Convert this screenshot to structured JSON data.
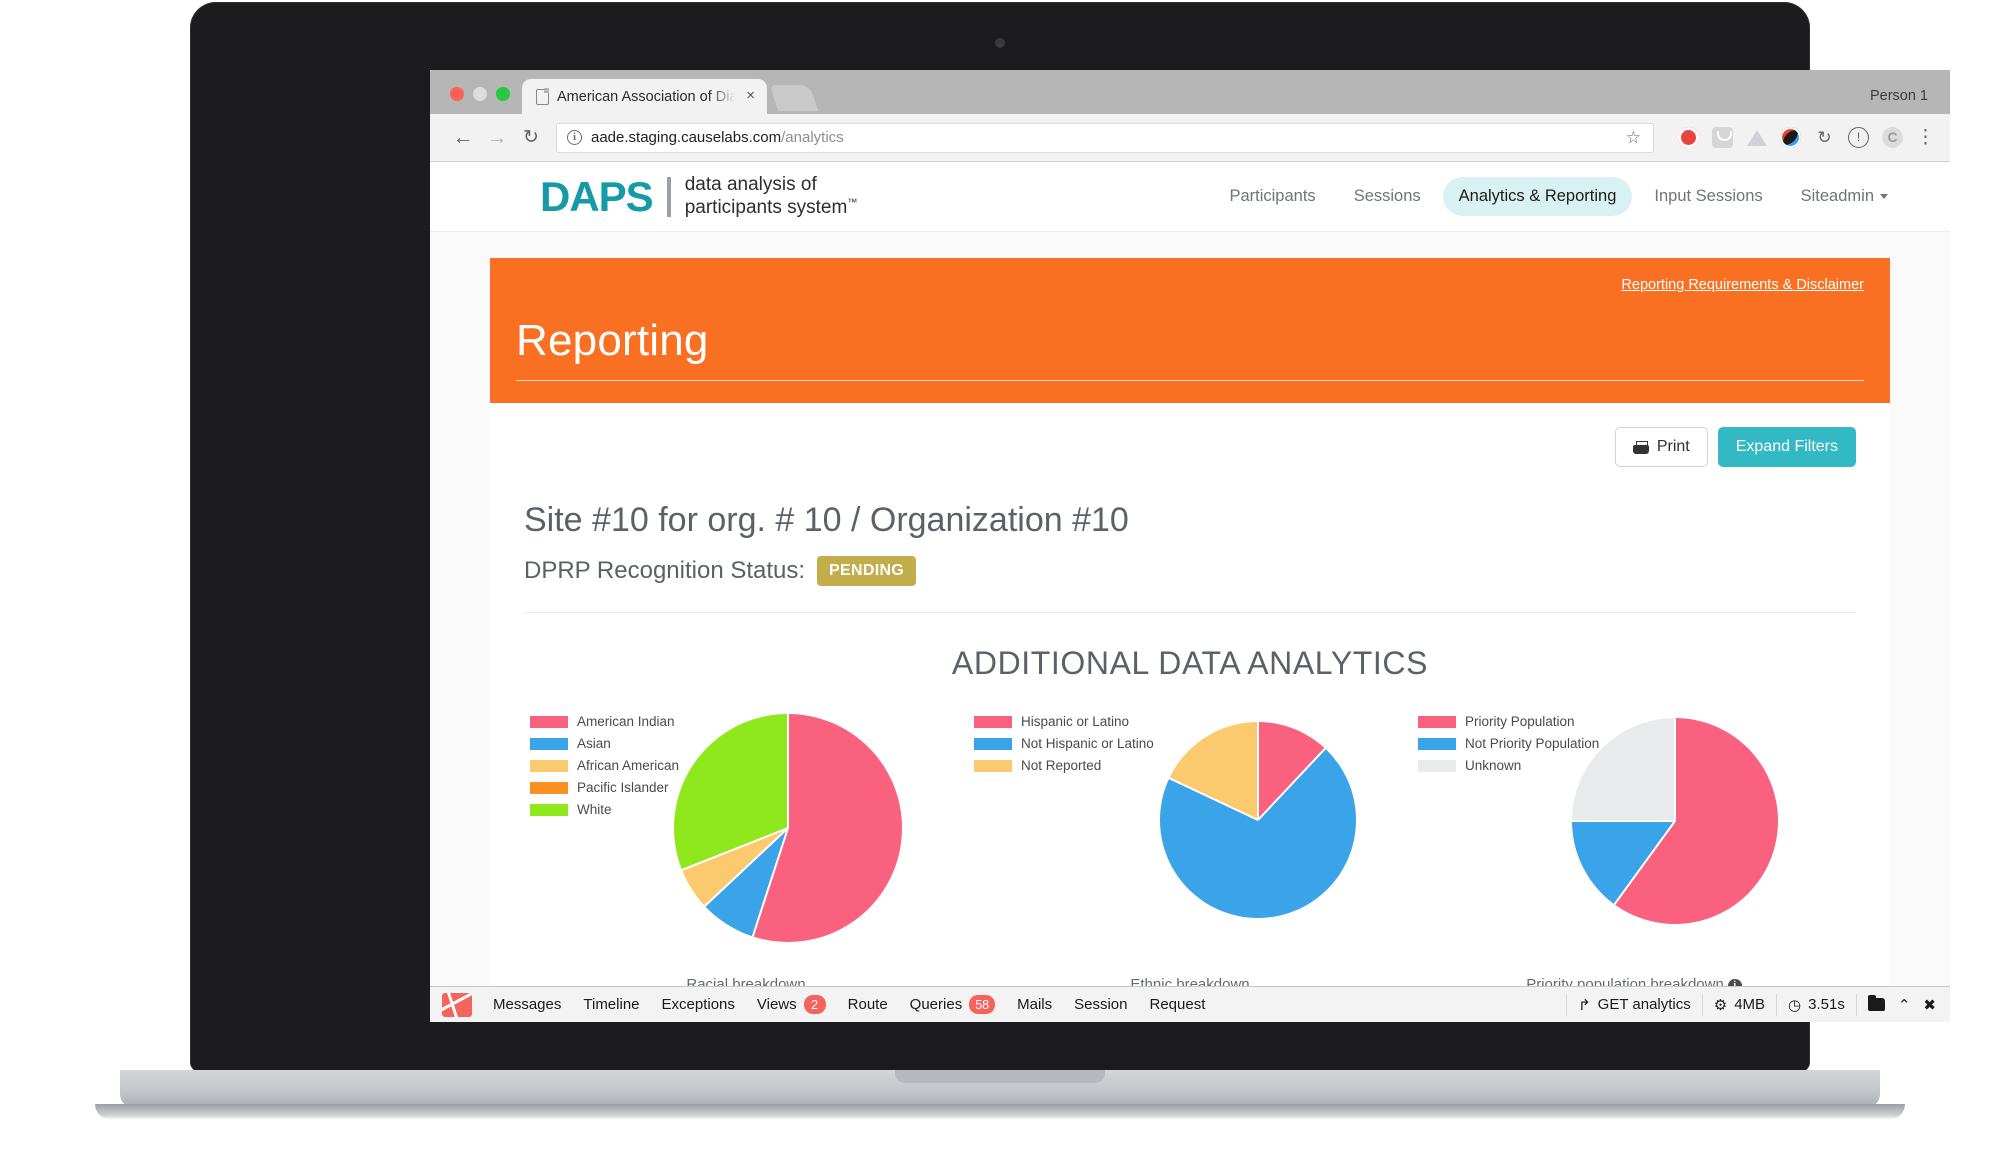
{
  "browser": {
    "tab_title": "American Association of Diabe",
    "tab_close": "×",
    "profile_label": "Person 1",
    "url_host": "aade.staging.causelabs.com",
    "url_path": "/analytics",
    "back_icon": "←",
    "forward_icon": "→",
    "reload_icon": "↻",
    "star_icon": "☆",
    "kebab_icon": "⋮",
    "sync_icon": "↻",
    "down_icon": "!",
    "gray_icon": "C"
  },
  "sitenav": {
    "logo_main": "DAPS",
    "logo_line1": "data analysis of",
    "logo_line2": "participants system",
    "logo_tm": "™",
    "links": [
      {
        "label": "Participants",
        "active": false
      },
      {
        "label": "Sessions",
        "active": false
      },
      {
        "label": "Analytics & Reporting",
        "active": true
      },
      {
        "label": "Input Sessions",
        "active": false
      },
      {
        "label": "Siteadmin",
        "active": false,
        "caret": true
      }
    ]
  },
  "header": {
    "disclaimer_link": "Reporting Requirements & Disclaimer",
    "title": "Reporting",
    "bg_color": "#f97022"
  },
  "toolbar": {
    "print_label": "Print",
    "expand_label": "Expand Filters",
    "expand_color": "#32b9c4"
  },
  "report": {
    "site_title": "Site #10 for org. # 10 / Organization #10",
    "status_label": "DPRP Recognition Status:",
    "status_value": "PENDING",
    "status_color": "#c3ad4b",
    "analytics_heading": "ADDITIONAL DATA ANALYTICS"
  },
  "chart_data": [
    {
      "type": "pie",
      "title": "Racial breakdown",
      "legend_position": "left",
      "categories": [
        "American Indian",
        "Asian",
        "African American",
        "Pacific Islander",
        "White"
      ],
      "values": [
        55,
        8,
        6,
        0,
        31
      ],
      "colors": [
        "#f9617f",
        "#3ba3e8",
        "#fcca6e",
        "#f99021",
        "#8ee81b"
      ]
    },
    {
      "type": "pie",
      "title": "Ethnic breakdown",
      "legend_position": "left",
      "categories": [
        "Hispanic or Latino",
        "Not Hispanic or Latino",
        "Not Reported"
      ],
      "values": [
        12,
        70,
        18
      ],
      "colors": [
        "#f9617f",
        "#3ba3e8",
        "#fcca6e"
      ]
    },
    {
      "type": "pie",
      "title": "Priority population breakdown",
      "legend_position": "left",
      "has_info_icon": true,
      "info_icon_glyph": "i",
      "categories": [
        "Priority Population",
        "Not Priority Population",
        "Unknown"
      ],
      "values": [
        60,
        15,
        25
      ],
      "colors": [
        "#f9617f",
        "#3ba3e8",
        "#e8eaec"
      ]
    }
  ],
  "debugbar": {
    "items": [
      {
        "label": "Messages",
        "badge": null
      },
      {
        "label": "Timeline",
        "badge": null
      },
      {
        "label": "Exceptions",
        "badge": null
      },
      {
        "label": "Views",
        "badge": "2"
      },
      {
        "label": "Route",
        "badge": null
      },
      {
        "label": "Queries",
        "badge": "58"
      },
      {
        "label": "Mails",
        "badge": null
      },
      {
        "label": "Session",
        "badge": null
      },
      {
        "label": "Request",
        "badge": null
      }
    ],
    "request_icon": "↱",
    "request_label": "GET analytics",
    "memory_icon": "⚙",
    "memory_label": "4MB",
    "time_icon": "◷",
    "time_label": "3.51s",
    "chevron_icon": "⌃",
    "close_icon": "✖"
  }
}
